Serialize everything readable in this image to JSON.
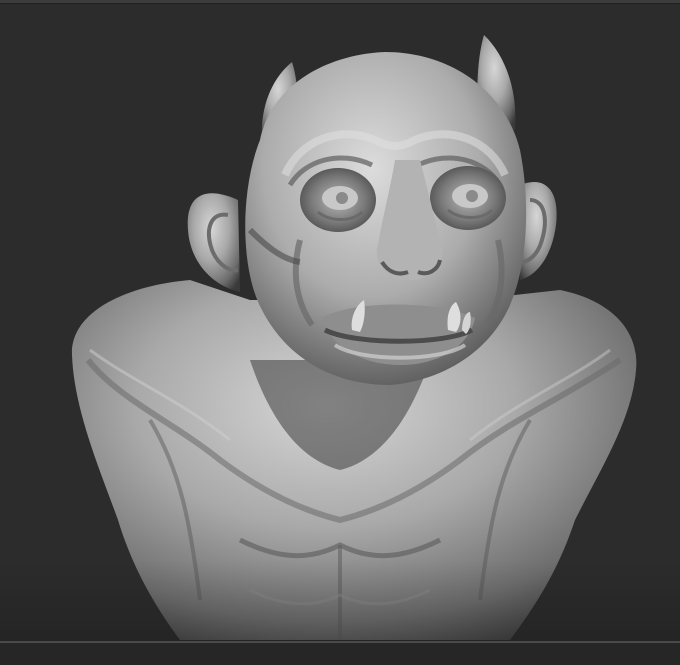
{
  "scene": {
    "subject": "sculpted-ogre-bust",
    "material": "clay-matcap",
    "colors": {
      "background": "#2c2c2c",
      "clay_highlight": "#d4d4d4",
      "clay_mid": "#9a9a9a",
      "clay_shadow": "#3a3a3a",
      "frame_rule": "#4a4a4a"
    }
  }
}
